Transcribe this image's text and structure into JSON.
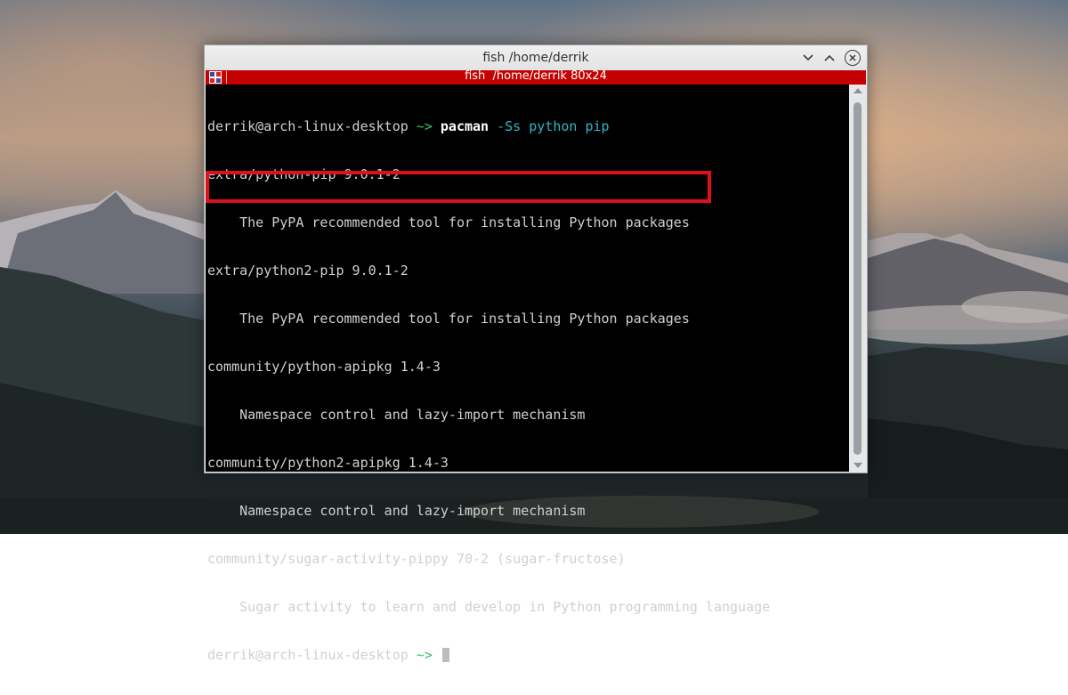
{
  "window": {
    "title": "fish /home/derrik",
    "minimize_icon": "chevron-down-icon",
    "maximize_icon": "chevron-up-icon",
    "close_icon": "close-icon"
  },
  "tab": {
    "title": "fish  /home/derrik 80x24",
    "color": "#c40000"
  },
  "terminal": {
    "prompt_user": "derrik@arch-linux-desktop",
    "prompt_dir": "~>",
    "command": "pacman",
    "args": "-Ss python pip",
    "output": [
      "extra/python-pip 9.0.1-2",
      "    The PyPA recommended tool for installing Python packages",
      "extra/python2-pip 9.0.1-2",
      "    The PyPA recommended tool for installing Python packages",
      "community/python-apipkg 1.4-3",
      "    Namespace control and lazy-import mechanism",
      "community/python2-apipkg 1.4-3",
      "    Namespace control and lazy-import mechanism",
      "community/sugar-activity-pippy 70-2 (sugar-fructose)",
      "    Sugar activity to learn and develop in Python programming language"
    ],
    "highlight_color": "#e0101a",
    "highlighted_lines": [
      2,
      3
    ]
  }
}
